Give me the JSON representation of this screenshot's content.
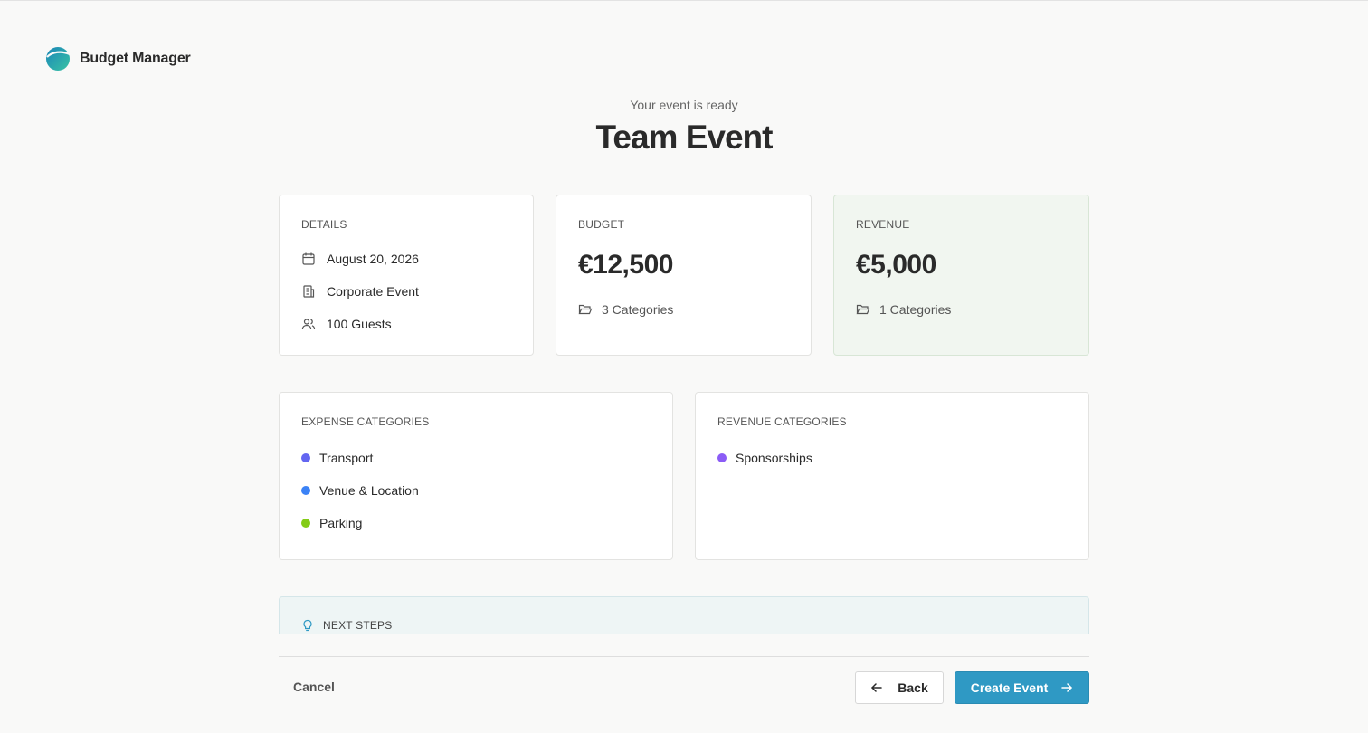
{
  "brand": {
    "name": "Budget Manager"
  },
  "header": {
    "subtitle": "Your event is ready",
    "title": "Team Event"
  },
  "details": {
    "label": "DETAILS",
    "date": "August 20, 2026",
    "type": "Corporate Event",
    "guests": "100 Guests"
  },
  "budget": {
    "label": "BUDGET",
    "amount": "€12,500",
    "categories": "3 Categories"
  },
  "revenue": {
    "label": "REVENUE",
    "amount": "€5,000",
    "categories": "1 Categories"
  },
  "expense_categories": {
    "label": "EXPENSE CATEGORIES",
    "items": [
      {
        "name": "Transport",
        "color": "#6366f1"
      },
      {
        "name": "Venue & Location",
        "color": "#3b82f6"
      },
      {
        "name": "Parking",
        "color": "#84cc16"
      }
    ]
  },
  "revenue_categories": {
    "label": "REVENUE CATEGORIES",
    "items": [
      {
        "name": "Sponsorships",
        "color": "#8b5cf6"
      }
    ]
  },
  "next_steps": {
    "label": "NEXT STEPS"
  },
  "footer": {
    "cancel": "Cancel",
    "back": "Back",
    "create": "Create Event"
  },
  "icons": {
    "logo": "budget-manager-logo",
    "date": "calendar-icon",
    "type": "building-icon",
    "guests": "users-icon",
    "categories": "folder-open-icon",
    "next_steps": "lightbulb-icon",
    "back": "arrow-left-icon",
    "create": "arrow-right-icon"
  }
}
